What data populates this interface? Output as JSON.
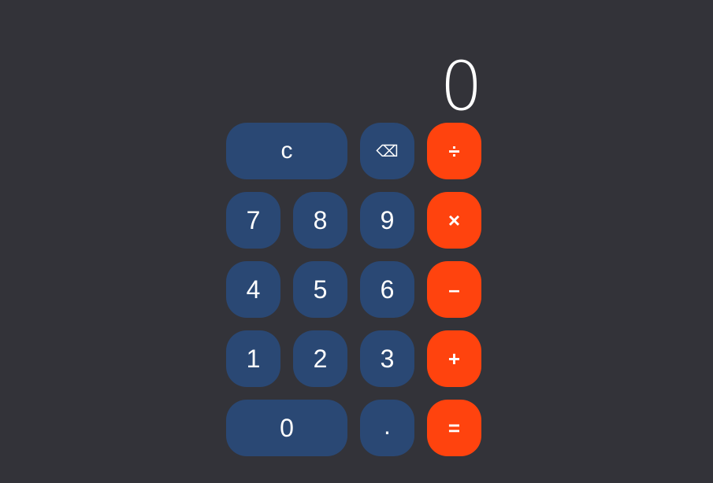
{
  "display": {
    "value": "0"
  },
  "keys": {
    "clear": "c",
    "backspace": "⌫",
    "divide": "÷",
    "seven": "7",
    "eight": "8",
    "nine": "9",
    "multiply": "×",
    "four": "4",
    "five": "5",
    "six": "6",
    "subtract": "–",
    "one": "1",
    "two": "2",
    "three": "3",
    "add": "+",
    "zero": "0",
    "decimal": ".",
    "equals": "="
  },
  "colors": {
    "background": "#333339",
    "number_key": "#2a4874",
    "operator_key": "#ff430e",
    "text": "#ffffff"
  }
}
